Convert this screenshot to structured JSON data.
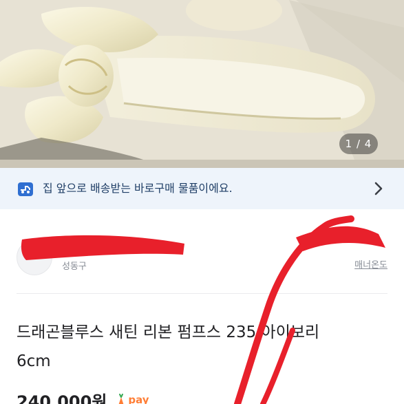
{
  "photo": {
    "counter": "1 / 4",
    "alt": "ivory satin ribbon pump shoe"
  },
  "banner": {
    "text": "집 앞으로 배송받는 바로구매 물품이에요.",
    "icon": "delivery-truck-icon",
    "arrow_icon": "chevron-right-icon"
  },
  "seller": {
    "location": "성동구",
    "manner_label": "매너온도"
  },
  "product": {
    "title": "드래곤블루스 새틴 리본 펌프스 235 아이보리 6cm",
    "price": "240,000원",
    "pay_label": "pay"
  },
  "colors": {
    "banner_bg": "#eef4fb",
    "banner_text": "#1f3e66",
    "accent_orange": "#ff7e36",
    "red_mark": "#e8202b"
  }
}
